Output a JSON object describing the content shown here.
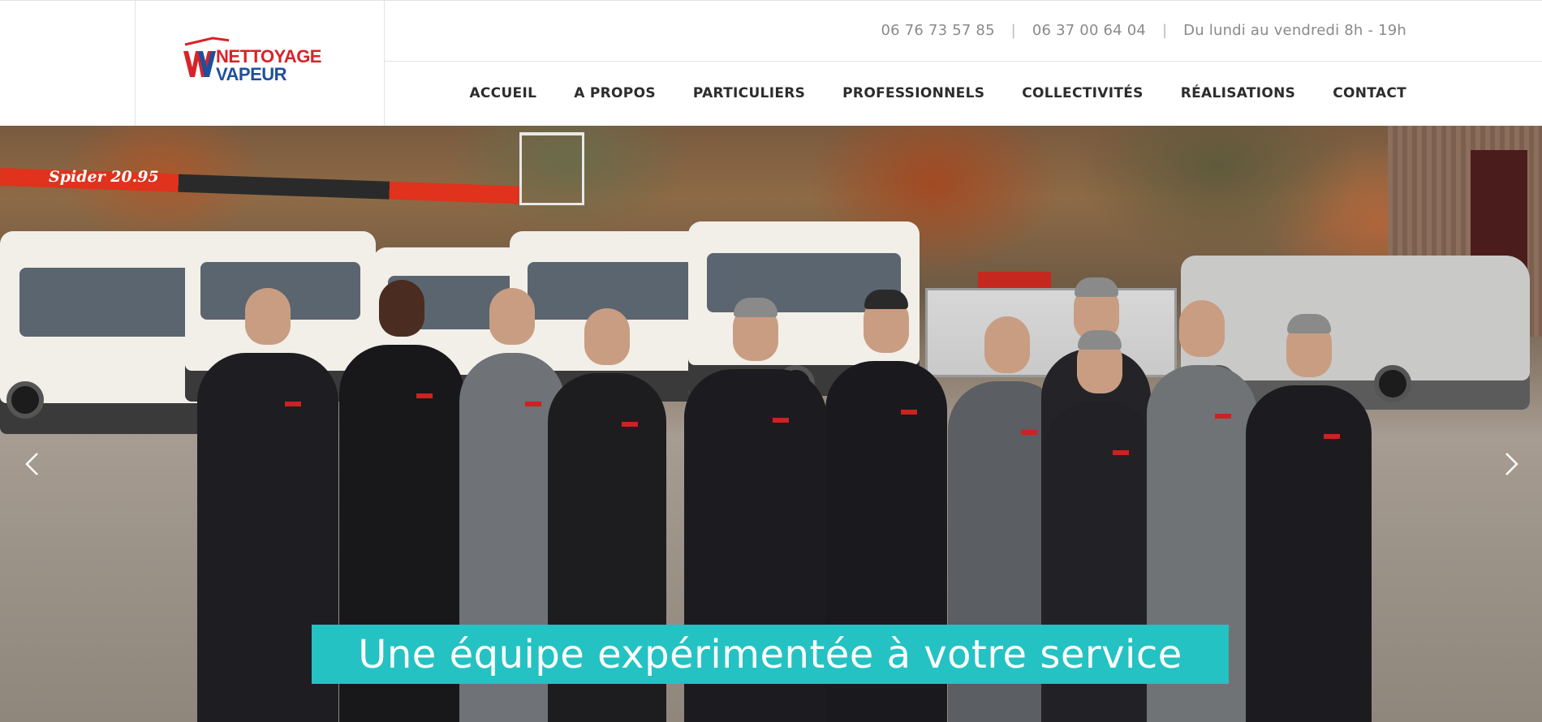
{
  "brand": {
    "logo_line1": "NETTOYAGE",
    "logo_line2": "VAPEUR",
    "logo_red": "#d82328",
    "logo_blue": "#1e4f9c"
  },
  "topbar": {
    "phone1": "06 76 73 57 85",
    "phone2": "06 37 00 64 04",
    "hours": "Du lundi au vendredi 8h - 19h",
    "separator": "|"
  },
  "nav": {
    "items": [
      {
        "label": "ACCUEIL"
      },
      {
        "label": "A PROPOS"
      },
      {
        "label": "PARTICULIERS"
      },
      {
        "label": "PROFESSIONNELS"
      },
      {
        "label": "COLLECTIVITÉS"
      },
      {
        "label": "RÉALISATIONS"
      },
      {
        "label": "CONTACT"
      }
    ]
  },
  "hero": {
    "crane_label": "Spider 20.95",
    "caption": "Une équipe expérimentée à votre service",
    "caption_bg": "#24c2c3",
    "prev_icon": "chevron-left-icon",
    "next_icon": "chevron-right-icon"
  }
}
